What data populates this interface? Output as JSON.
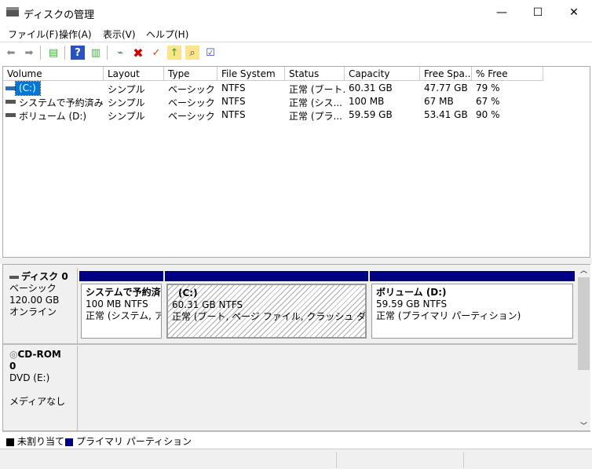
{
  "window": {
    "title": "ディスクの管理",
    "icon": "disk-management-icon",
    "minimize": "—",
    "maximize": "☐",
    "close": "✕"
  },
  "menu": [
    "ファイル(F)",
    "操作(A)",
    "表示(V)",
    "ヘルプ(H)"
  ],
  "toolbar": [
    "back-icon",
    "forward-icon",
    "console-tree-icon",
    "help-icon",
    "action-pane-icon",
    "connect-drive-icon",
    "delete-icon",
    "check-icon",
    "folder-up-icon",
    "search-folder-icon",
    "properties-list-icon"
  ],
  "volumes": {
    "columns": [
      "Volume",
      "Layout",
      "Type",
      "File System",
      "Status",
      "Capacity",
      "Free Spa...",
      "% Free"
    ],
    "rows": [
      [
        "(C:)",
        "シンプル",
        "ベーシック",
        "NTFS",
        "正常 (ブート...",
        "60.31 GB",
        "47.77 GB",
        "79 %"
      ],
      [
        "システムで予約済み",
        "シンプル",
        "ベーシック",
        "NTFS",
        "正常 (シス...",
        "100 MB",
        "67 MB",
        "67 %"
      ],
      [
        "ボリューム (D:)",
        "シンプル",
        "ベーシック",
        "NTFS",
        "正常 (プラ...",
        "59.59 GB",
        "53.41 GB",
        "90 %"
      ]
    ]
  },
  "disks": [
    {
      "name": "ディスク 0",
      "type": "ベーシック",
      "size": "120.00 GB",
      "state": "オンライン",
      "partitions": [
        {
          "name": "システムで予約済み",
          "fs": "100 MB NTFS",
          "status": "正常 (システム, アク"
        },
        {
          "name": "(C:)",
          "fs": "60.31 GB NTFS",
          "status": "正常 (ブート, ページ ファイル, クラッシュ ダンプ, プライマ"
        },
        {
          "name": "ボリューム  (D:)",
          "fs": "59.59 GB NTFS",
          "status": "正常 (プライマリ パーティション)"
        }
      ]
    },
    {
      "name": "CD-ROM 0",
      "type": "DVD (E:)",
      "size": "",
      "state": "メディアなし"
    }
  ],
  "legend": [
    {
      "label": "未割り当て",
      "color": "#000000"
    },
    {
      "label": "プライマリ パーティション",
      "color": "#000080"
    }
  ],
  "colors": {
    "selection": "#0078d7",
    "partition_bar": "#000080"
  }
}
